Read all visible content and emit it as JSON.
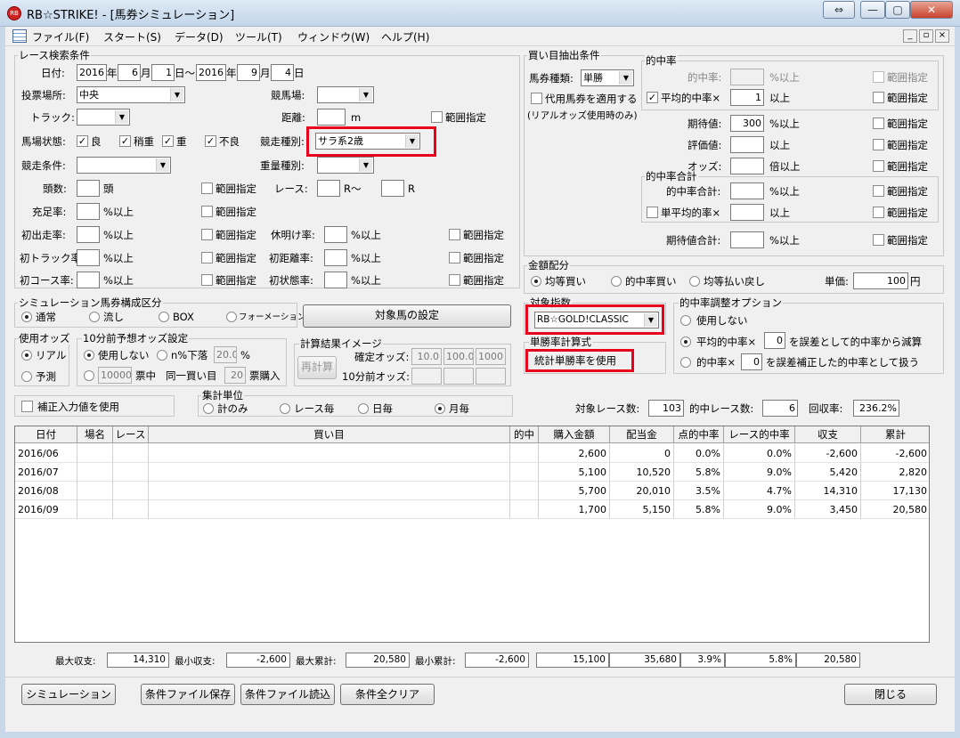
{
  "window": {
    "title": "RB☆STRIKE! - [馬券シミュレーション]",
    "icon": "rb-app-icon",
    "buttons": [
      "⇔",
      "—",
      "▢",
      "✕"
    ]
  },
  "menu": [
    "ファイル(F)",
    "スタート(S)",
    "データ(D)",
    "ツール(T)",
    "ウィンドウ(W)",
    "ヘルプ(H)"
  ],
  "mdi": [
    "_",
    "▫",
    "×"
  ],
  "race": {
    "title": "レース検索条件",
    "date_label": "日付:",
    "date_from": {
      "y": "2016",
      "m": "6",
      "d": "1"
    },
    "date_to": {
      "y": "2016",
      "m": "9",
      "d": "4"
    },
    "u_year": "年",
    "u_month": "月",
    "u_day_range": "日～",
    "u_day": "日",
    "venue_label": "投票場所:",
    "venue": "中央",
    "course_label": "競馬場:",
    "course": "",
    "track_label": "トラック:",
    "track": "",
    "distance_label": "距離:",
    "distance": "",
    "distance_unit": "m",
    "range": "範囲指定",
    "going_label": "馬場状態:",
    "going": [
      "良",
      "稍重",
      "重",
      "不良"
    ],
    "type_label": "競走種別:",
    "type": "サラ系2歳",
    "cond_label": "競走条件:",
    "cond": "",
    "weight_label": "重量種別:",
    "weight": "",
    "heads_label": "頭数:",
    "heads_unit": "頭",
    "race_label": "レース:",
    "race_r1": "R～",
    "race_r2": "R",
    "fill_label": "充足率:",
    "first_run_label": "初出走率:",
    "rest_label": "休明け率:",
    "first_track_label": "初トラック率:",
    "first_dist_label": "初距離率:",
    "first_course_label": "初コース率:",
    "first_state_label": "初状態率:",
    "pct_over": "%以上"
  },
  "sim": {
    "title": "シミュレーション馬券構成区分",
    "options": [
      "通常",
      "流し",
      "BOX",
      "フォーメーション"
    ],
    "selected": "通常",
    "target_btn": "対象馬の設定"
  },
  "odds": {
    "title": "使用オッズ",
    "options": [
      "リアル",
      "予測"
    ],
    "selected": "リアル"
  },
  "odds10": {
    "title": "10分前予想オッズ設定",
    "opt1": "使用しない",
    "opt2": "n%下落",
    "n": "20.0",
    "pct": "%",
    "amount": "10000",
    "ticket_mid": "票中",
    "same": "同一買い目",
    "count": "20",
    "buy": "票購入"
  },
  "calc": {
    "title": "計算結果イメージ",
    "recalc": "再計算",
    "fixed_label": "確定オッズ:",
    "fixed": [
      "10.0",
      "100.0",
      "1000"
    ],
    "before_label": "10分前オッズ:"
  },
  "correction": "補正入力値を使用",
  "agg": {
    "title": "集計単位",
    "options": [
      "計のみ",
      "レース毎",
      "日毎",
      "月毎"
    ],
    "selected": "月毎"
  },
  "buy": {
    "title": "買い目抽出条件",
    "ticket_label": "馬券種類:",
    "ticket": "単勝",
    "substitute": "代用馬券を適用する",
    "substitute_note": "(リアルオッズ使用時のみ)",
    "hit_title": "的中率",
    "hit_label": "的中率:",
    "hit_over": "%以上",
    "avg_label": "平均的中率×",
    "avg_val": "1",
    "over": "以上",
    "exp_label": "期待値:",
    "exp_val": "300",
    "exp_unit": "%以上",
    "score_label": "評価値:",
    "odds_label": "オッズ:",
    "odds_unit": "倍以上",
    "sum_title": "的中率合計",
    "sum_label": "的中率合計:",
    "single_avg": "単平均的率×",
    "exp_total_label": "期待値合計:",
    "range": "範囲指定"
  },
  "money": {
    "title": "金額配分",
    "options": [
      "均等買い",
      "的中率買い",
      "均等払い戻し"
    ],
    "selected": "均等買い",
    "unit_label": "単価:",
    "unit": "100",
    "yen": "円"
  },
  "index": {
    "title": "対象指数",
    "value": "RB☆GOLD!CLASSIC"
  },
  "rate": {
    "title": "単勝率計算式",
    "value": "統計単勝率を使用"
  },
  "adjust": {
    "title": "的中率調整オプション",
    "opt1": "使用しない",
    "opt2": "平均的中率×",
    "v2": "0",
    "t2": "を誤差として的中率から減算",
    "opt3": "的中率×",
    "v3": "0",
    "t3": "を誤差補正した的中率として扱う",
    "selected": "opt2"
  },
  "stats": {
    "races_label": "対象レース数:",
    "races": "103",
    "hits_label": "的中レース数:",
    "hits": "6",
    "return_label": "回収率:",
    "return": "236.2%"
  },
  "table": {
    "headers": [
      "日付",
      "場名",
      "レース",
      "買い目",
      "的中",
      "購入金額",
      "配当金",
      "点的中率",
      "レース的中率",
      "収支",
      "累計"
    ],
    "rows": [
      [
        "2016/06",
        "",
        "",
        "",
        "",
        "2,600",
        "0",
        "0.0%",
        "0.0%",
        "-2,600",
        "-2,600"
      ],
      [
        "2016/07",
        "",
        "",
        "",
        "",
        "5,100",
        "10,520",
        "5.8%",
        "9.0%",
        "5,420",
        "2,820"
      ],
      [
        "2016/08",
        "",
        "",
        "",
        "",
        "5,700",
        "20,010",
        "3.5%",
        "4.7%",
        "14,310",
        "17,130"
      ],
      [
        "2016/09",
        "",
        "",
        "",
        "",
        "1,700",
        "5,150",
        "5.8%",
        "9.0%",
        "3,450",
        "20,580"
      ]
    ]
  },
  "summary": {
    "max_label": "最大収支:",
    "max": "14,310",
    "min_label": "最小収支:",
    "min": "-2,600",
    "maxc_label": "最大累計:",
    "maxc": "20,580",
    "minc_label": "最小累計:",
    "minc": "-2,600",
    "totals": [
      "15,100",
      "35,680",
      "3.9%",
      "5.8%",
      "20,580"
    ]
  },
  "buttons": {
    "simulate": "シミュレーション",
    "save": "条件ファイル保存",
    "load": "条件ファイル読込",
    "clear": "条件全クリア",
    "close": "閉じる"
  }
}
